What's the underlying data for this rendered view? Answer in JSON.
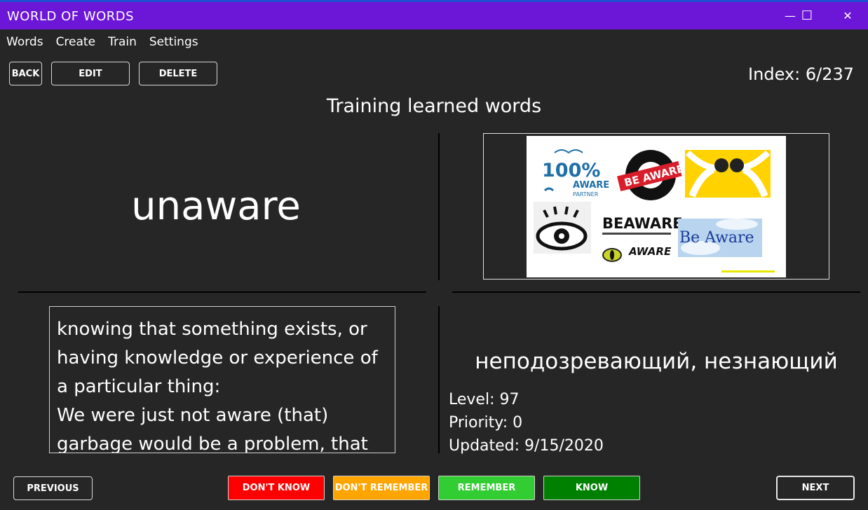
{
  "app": {
    "title": "WORLD OF WORDS"
  },
  "window_controls": {
    "minimize": "—",
    "maximize": "☐",
    "close": "✕"
  },
  "menu": {
    "items": [
      "Words",
      "Create",
      "Train",
      "Settings"
    ]
  },
  "toolbar": {
    "back": "BACK",
    "edit": "EDIT",
    "delete": "DELETE"
  },
  "index_label": "Index: 6/237",
  "heading": "Training learned words",
  "card": {
    "word": "unaware",
    "definition": "knowing that something exists, or having knowledge or experience of a particular thing:\nWe were just not aware (that) garbage would be a problem, that",
    "translation": "неподозревающий, незнающий",
    "level": "Level: 97",
    "priority": "Priority: 0",
    "updated": "Updated: 9/15/2020"
  },
  "image_collage": {
    "logo_100": "100%",
    "logo_aware": "AWARE",
    "logo_partner": "PARTNER",
    "sticker_be_aware": "BE AWARE",
    "logo_beaware_top": "BEAWARE",
    "logo_aware_bottom": "AWARE",
    "sky_text": "Be Aware"
  },
  "bottom": {
    "previous": "PREVIOUS",
    "dont_know": "DON'T KNOW",
    "dont_remember": "DON'T REMEMBER",
    "remember": "REMEMBER",
    "know": "KNOW",
    "next": "NEXT"
  },
  "colors": {
    "titlebar": "#6c16d8",
    "dont_know": "#ff0000",
    "dont_remember": "#ffa500",
    "remember": "#32cd32",
    "know": "#008000"
  }
}
